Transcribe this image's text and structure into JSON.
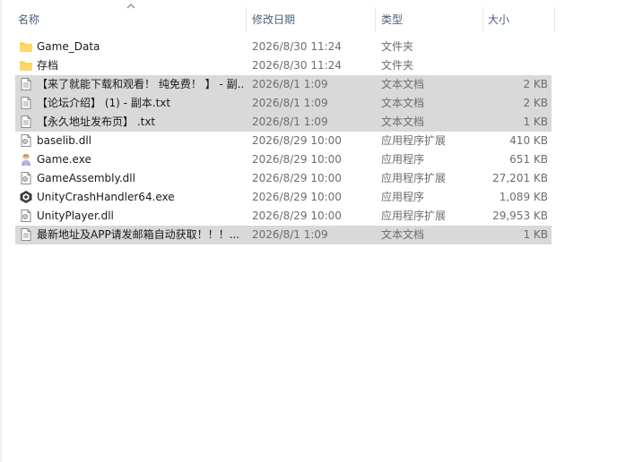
{
  "columns": {
    "name": "名称",
    "date": "修改日期",
    "type": "类型",
    "size": "大小"
  },
  "files": [
    {
      "name": "Game_Data",
      "date": "2026/8/30 11:24",
      "type": "文件夹",
      "size": "",
      "icon": "folder-icon",
      "selected": false
    },
    {
      "name": "存档",
      "date": "2026/8/30 11:24",
      "type": "文件夹",
      "size": "",
      "icon": "folder-icon",
      "selected": false
    },
    {
      "name": "【来了就能下载和观看！ 纯免费！ 】 - 副...",
      "date": "2026/8/1 1:09",
      "type": "文本文档",
      "size": "2 KB",
      "icon": "text-file-icon",
      "selected": true
    },
    {
      "name": "【论坛介绍】 (1) - 副本.txt",
      "date": "2026/8/1 1:09",
      "type": "文本文档",
      "size": "2 KB",
      "icon": "text-file-icon",
      "selected": true
    },
    {
      "name": "【永久地址发布页】 .txt",
      "date": "2026/8/1 1:09",
      "type": "文本文档",
      "size": "1 KB",
      "icon": "text-file-icon",
      "selected": true
    },
    {
      "name": "baselib.dll",
      "date": "2026/8/29 10:00",
      "type": "应用程序扩展",
      "size": "410 KB",
      "icon": "dll-file-icon",
      "selected": false
    },
    {
      "name": "Game.exe",
      "date": "2026/8/29 10:00",
      "type": "应用程序",
      "size": "651 KB",
      "icon": "game-exe-icon",
      "selected": false
    },
    {
      "name": "GameAssembly.dll",
      "date": "2026/8/29 10:00",
      "type": "应用程序扩展",
      "size": "27,201 KB",
      "icon": "dll-file-icon",
      "selected": false
    },
    {
      "name": "UnityCrashHandler64.exe",
      "date": "2026/8/29 10:00",
      "type": "应用程序",
      "size": "1,089 KB",
      "icon": "unity-exe-icon",
      "selected": false
    },
    {
      "name": "UnityPlayer.dll",
      "date": "2026/8/29 10:00",
      "type": "应用程序扩展",
      "size": "29,953 KB",
      "icon": "dll-file-icon",
      "selected": false
    },
    {
      "name": "最新地址及APP请发邮箱自动获取！！！...",
      "date": "2026/8/1 1:09",
      "type": "文本文档",
      "size": "1 KB",
      "icon": "text-file-icon",
      "selected": true
    }
  ]
}
